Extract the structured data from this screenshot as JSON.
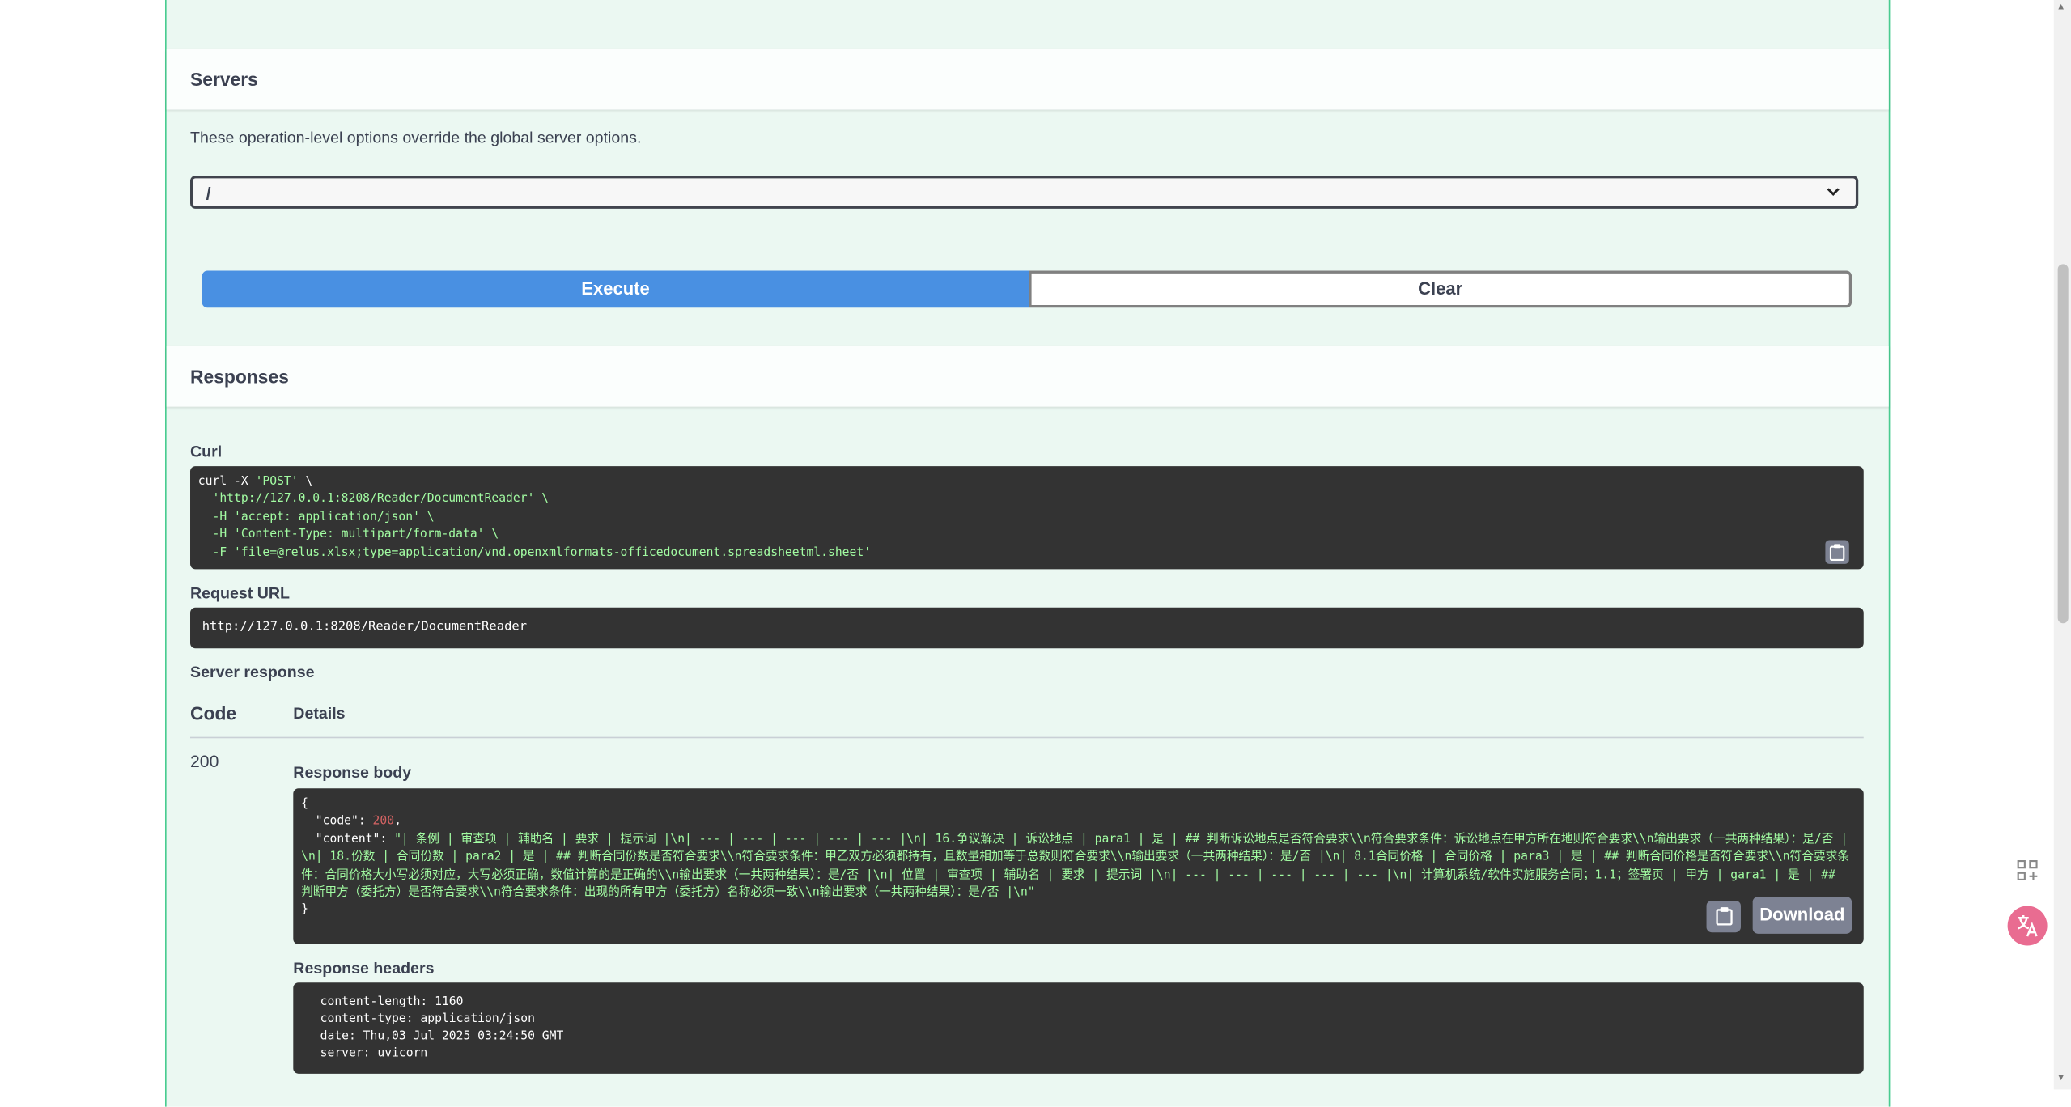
{
  "servers": {
    "title": "Servers",
    "description": "These operation-level options override the global server options.",
    "selected": "/"
  },
  "actions": {
    "execute_label": "Execute",
    "clear_label": "Clear"
  },
  "responses": {
    "title": "Responses",
    "curl_label": "Curl",
    "curl_lines": [
      "curl -X 'POST' \\",
      "  'http://127.0.0.1:8208/Reader/DocumentReader' \\",
      "  -H 'accept: application/json' \\",
      "  -H 'Content-Type: multipart/form-data' \\",
      "  -F 'file=@relus.xlsx;type=application/vnd.openxmlformats-officedocument.spreadsheetml.sheet'"
    ],
    "request_url_label": "Request URL",
    "request_url": "http://127.0.0.1:8208/Reader/DocumentReader",
    "server_response_label": "Server response",
    "code_header": "Code",
    "details_header": "Details",
    "status_code": "200",
    "response_body_label": "Response body",
    "body_open": "{",
    "body_code_key": "  \"code\": ",
    "body_code_value": "200",
    "body_content_key": "  \"content\": ",
    "body_content_value": "\"| 条例 | 审查项 | 辅助名 | 要求 | 提示词 |\\n| --- | --- | --- | --- | --- |\\n| 16.争议解决 | 诉讼地点 | para1 | 是 | ## 判断诉讼地点是否符合要求\\\\n符合要求条件：诉讼地点在甲方所在地则符合要求\\\\n输出要求（一共两种结果）：是/否 |\\n| 18.份数 | 合同份数 | para2 | 是 | ## 判断合同份数是否符合要求\\\\n符合要求条件：甲乙双方必须都持有，且数量相加等于总数则符合要求\\\\n输出要求（一共两种结果）：是/否 |\\n| 8.1合同价格 | 合同价格 | para3 | 是 | ## 判断合同价格是否符合要求\\\\n符合要求条件：合同价格大小写必须对应，大写必须正确，数值计算的是正确的\\\\n输出要求（一共两种结果）：是/否 |\\n| 位置 | 审查项 | 辅助名 | 要求 | 提示词 |\\n| --- | --- | --- | --- | --- |\\n| 计算机系统/软件实施服务合同；1.1；签署页 | 甲方 | gara1 | 是 | ## 判断甲方（委托方）是否符合要求\\\\n符合要求条件：出现的所有甲方（委托方）名称必须一致\\\\n输出要求（一共两种结果）：是/否 |\\n\"",
    "body_close": "}",
    "download_label": "Download",
    "response_headers_label": "Response headers",
    "headers": [
      " content-length: 1160 ",
      " content-type: application/json ",
      " date: Thu,03 Jul 2025 03:24:50 GMT ",
      " server: uvicorn "
    ]
  },
  "colors": {
    "opblock_bg": "#ebf8f2",
    "opblock_border": "#49cc90",
    "execute_bg": "#4990e2",
    "code_bg": "#333333",
    "string_color": "#a2fca2",
    "number_color": "#d36363"
  },
  "icons": [
    "chevron-down-icon",
    "copy-icon",
    "grid-apps-icon",
    "translate-icon"
  ]
}
